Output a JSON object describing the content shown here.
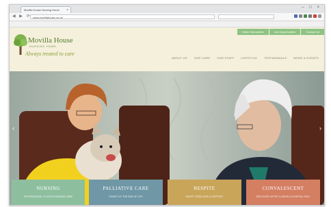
{
  "browser": {
    "tab_title": "Movilla House Nursing Home",
    "url": "www.movillahouse.co.uk"
  },
  "site": {
    "logo_name": "Movilla House",
    "logo_sub": "NURSING HOME",
    "logo_tagline": "Always treated to care",
    "util_links": [
      "Visitor Information",
      "Job Opportunities",
      "Contact Us"
    ],
    "nav": [
      "ABOUT US",
      "OUR CARE",
      "OUR STAFF",
      "LIFESTYLE",
      "TESTIMONIALS",
      "NEWS & EVENTS"
    ]
  },
  "cards": [
    {
      "title": "NURSING",
      "sub": "PROFESSIONAL 24 HOUR NURSING CARE",
      "color": "#8dbf9f"
    },
    {
      "title": "PALLIATIVE CARE",
      "sub": "DIGNITY AT THE END OF LIFE",
      "color": "#6f97a6"
    },
    {
      "title": "RESPITE",
      "sub": "SHORT TERM CARE & SUPPORT",
      "color": "#c9a55a"
    },
    {
      "title": "CONVALESCENT",
      "sub": "RECOVERY AFTER ILLNESS & HOSPITAL STAY",
      "color": "#d47f62"
    }
  ]
}
